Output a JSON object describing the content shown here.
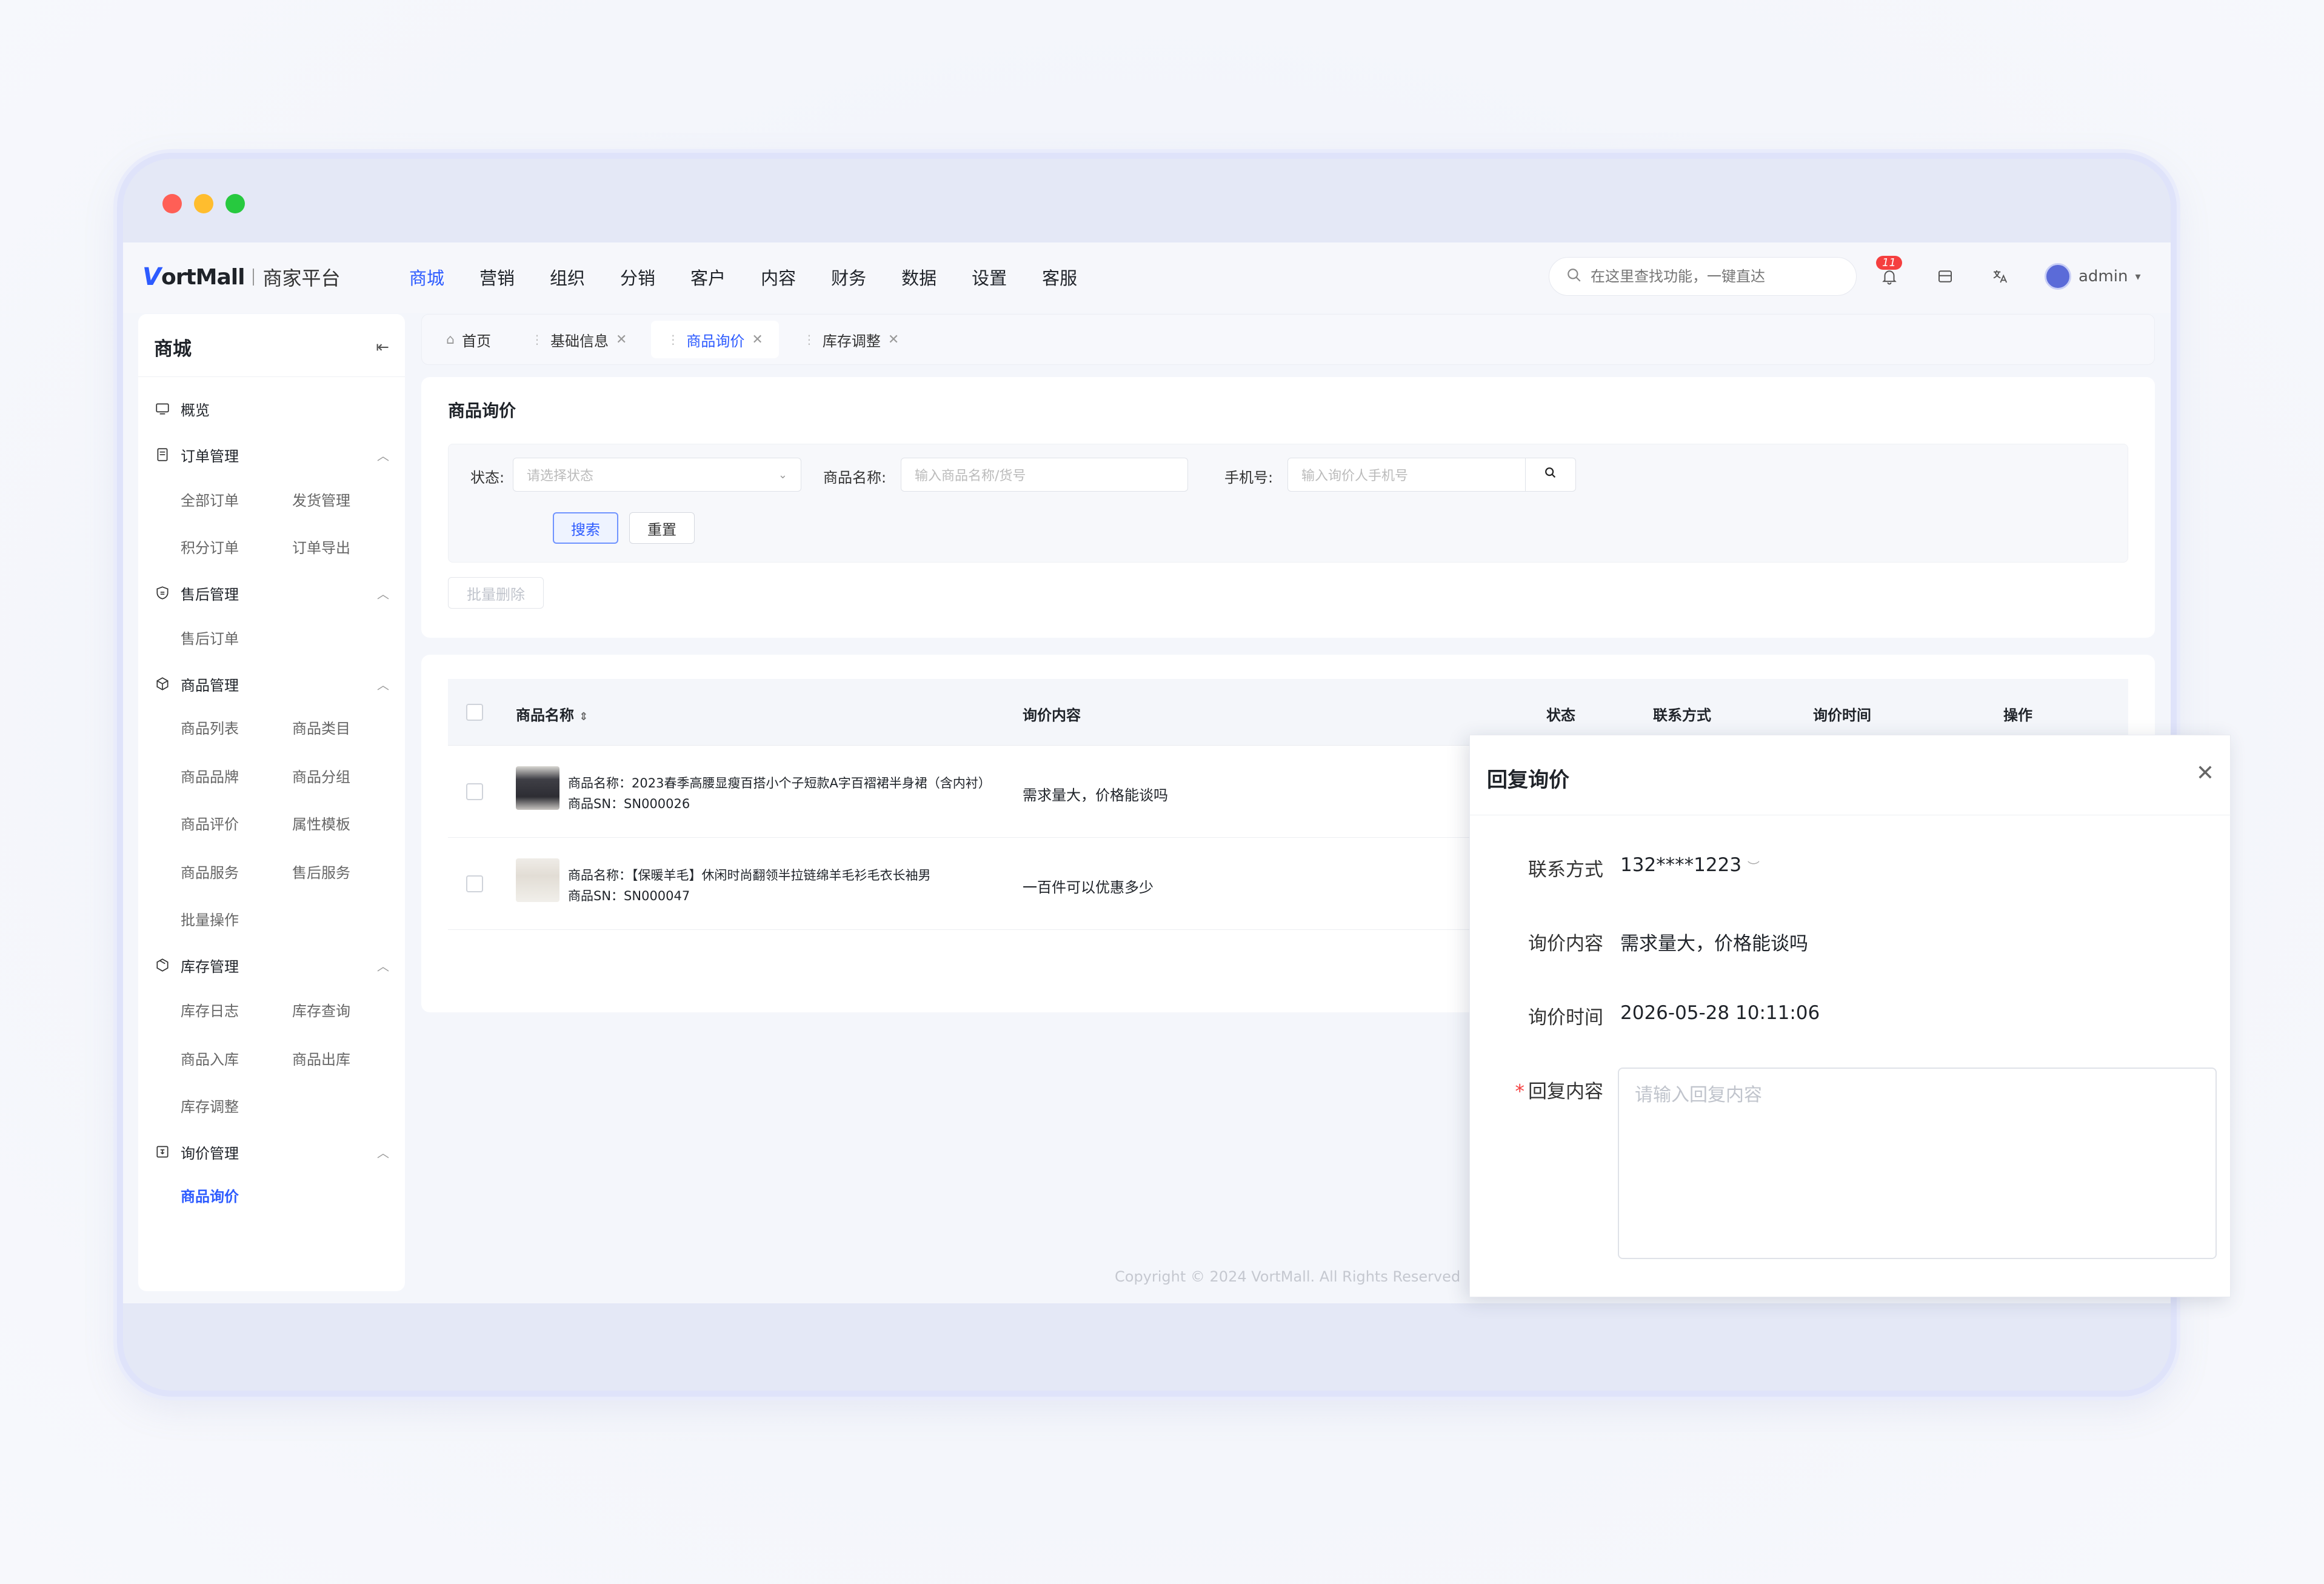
{
  "window": {
    "dot_colors": [
      "#ff5f56",
      "#ffbd2e",
      "#27c93f"
    ]
  },
  "logo": {
    "mark": "V",
    "name": "ortMall",
    "subtitle": "商家平台"
  },
  "topnav": {
    "items": [
      "商城",
      "营销",
      "组织",
      "分销",
      "客户",
      "内容",
      "财务",
      "数据",
      "设置",
      "客服"
    ],
    "active_index": 0,
    "search_placeholder": "在这里查找功能，一键直达",
    "notification_count": "11",
    "user_name": "admin"
  },
  "sidebar": {
    "title": "商城",
    "overview": "概览",
    "groups": [
      {
        "label": "订单管理",
        "icon": "order-icon",
        "items": [
          "全部订单",
          "发货管理",
          "积分订单",
          "订单导出"
        ]
      },
      {
        "label": "售后管理",
        "icon": "aftersale-icon",
        "items": [
          "售后订单"
        ]
      },
      {
        "label": "商品管理",
        "icon": "product-icon",
        "items": [
          "商品列表",
          "商品类目",
          "商品品牌",
          "商品分组",
          "商品评价",
          "属性模板",
          "商品服务",
          "售后服务",
          "批量操作"
        ]
      },
      {
        "label": "库存管理",
        "icon": "inventory-icon",
        "items": [
          "库存日志",
          "库存查询",
          "商品入库",
          "商品出库",
          "库存调整"
        ]
      },
      {
        "label": "询价管理",
        "icon": "inquiry-icon",
        "items": [
          "商品询价"
        ]
      }
    ],
    "active_item": "商品询价"
  },
  "tabs": [
    {
      "label": "首页",
      "closable": false,
      "active": false
    },
    {
      "label": "基础信息",
      "closable": true,
      "active": false
    },
    {
      "label": "商品询价",
      "closable": true,
      "active": true
    },
    {
      "label": "库存调整",
      "closable": true,
      "active": false
    }
  ],
  "page": {
    "title": "商品询价",
    "filters": {
      "status_label": "状态:",
      "status_placeholder": "请选择状态",
      "name_label": "商品名称:",
      "name_placeholder": "输入商品名称/货号",
      "phone_label": "手机号:",
      "phone_placeholder": "输入询价人手机号"
    },
    "search_btn": "搜索",
    "reset_btn": "重置",
    "batch_delete_btn": "批量删除"
  },
  "table": {
    "columns": [
      "商品名称",
      "询价内容",
      "状态",
      "联系方式",
      "询价时间",
      "操作"
    ],
    "rows": [
      {
        "name": "商品名称：2023春季高腰显瘦百搭小个子短款A字百褶裙半身裙（含内衬）",
        "sn": "商品SN：SN000026",
        "inquiry": "需求量大，价格能谈吗",
        "thumb_color": "#4a4a52"
      },
      {
        "name": "商品名称：【保暖羊毛】休闲时尚翻领半拉链绵羊毛衫毛衣长袖男",
        "sn": "商品SN：SN000047",
        "inquiry": "一百件可以优惠多少",
        "thumb_color": "#e8e4de"
      }
    ]
  },
  "footer": "Copyright © 2024 VortMall. All Rights Reserved",
  "drawer": {
    "title": "回复询价",
    "contact_label": "联系方式",
    "contact_value": "132****1223",
    "content_label": "询价内容",
    "content_value": "需求量大，价格能谈吗",
    "time_label": "询价时间",
    "time_value": "2026-05-28 10:11:06",
    "reply_label": "回复内容",
    "reply_required_mark": "*",
    "reply_placeholder": "请输入回复内容"
  }
}
